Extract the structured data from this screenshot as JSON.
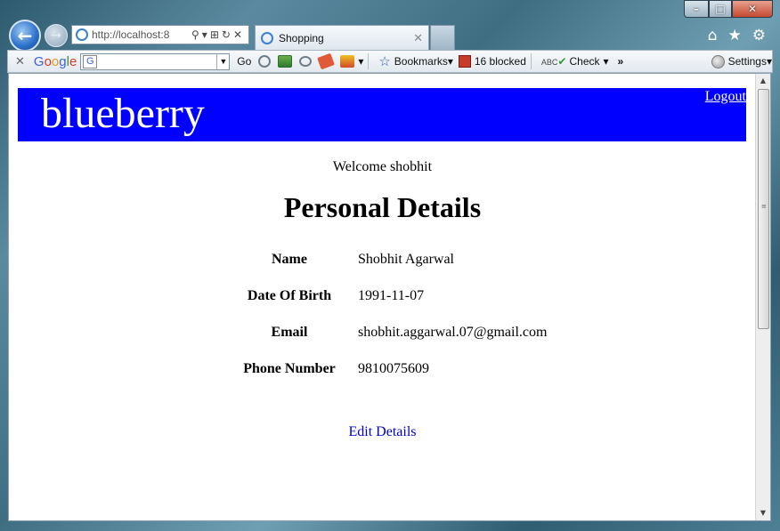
{
  "browser": {
    "address_url": "http://localhost:8",
    "tab_title": "Shopping"
  },
  "toolbar": {
    "google": "Google",
    "go_label": "Go",
    "bookmarks_label": "Bookmarks",
    "blocked_label": "16 blocked",
    "check_label": "Check",
    "more_label": "»",
    "settings_label": "Settings"
  },
  "page": {
    "brand": "blueberry",
    "logout": "Logout",
    "welcome": "Welcome shobhit",
    "title": "Personal Details",
    "details": [
      {
        "label": "Name",
        "value": "Shobhit Agarwal"
      },
      {
        "label": "Date Of Birth",
        "value": "1991-11-07"
      },
      {
        "label": "Email",
        "value": "shobhit.aggarwal.07@gmail.com"
      },
      {
        "label": "Phone Number",
        "value": "9810075609"
      }
    ],
    "edit_link": "Edit Details",
    "banner_color": "#0000ff",
    "link_color": "#0000cc"
  }
}
